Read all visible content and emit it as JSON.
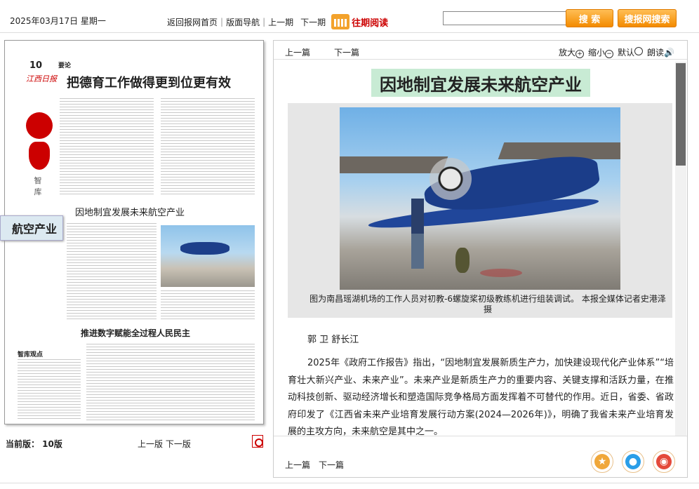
{
  "header": {
    "date": "2025年03月17日 星期一",
    "nav": [
      "返回报网首页",
      "版面导航",
      "上一期",
      "下一期"
    ],
    "past_reading": "往期阅读",
    "search_placeholder": "",
    "search_button": "搜 索",
    "site_search_button": "搜报网搜索"
  },
  "page_preview": {
    "page_number": "10",
    "masthead": "江西日报",
    "column_label": "要论",
    "headline": "把德育工作做得更到位更有效",
    "sidebar_label": "智\n库",
    "sub_article": "因地制宜发展未来航空产业",
    "sub_article2": "推进数字赋能全过程人民民主",
    "column_label2": "智库观点",
    "callout": "航空产业"
  },
  "left_footer": {
    "current_edition": "当前版： 10版",
    "prev_edition": "上一版",
    "next_edition": "下一版"
  },
  "article": {
    "top_prev": "上一篇",
    "top_next": "下一篇",
    "tools": {
      "zoom_in": "放大",
      "zoom_out": "缩小",
      "default": "默认",
      "read": "朗读"
    },
    "title": "因地制宜发展未来航空产业",
    "caption": "图为南昌瑶湖机场的工作人员对初教-6螺旋桨初级教练机进行组装调试。 本报全媒体记者史港泽摄",
    "author": "郭 卫  舒长江",
    "body": "2025年《政府工作报告》指出，“因地制宜发展新质生产力，加快建设现代化产业体系”“培育壮大新兴产业、未来产业”。未来产业是新质生产力的重要内容、关键支撑和活跃力量，在推动科技创新、驱动经济增长和塑造国际竞争格局方面发挥着不可替代的作用。近日，省委、省政府印发了《江西省未来产业培育发展行动方案(2024—2026年)》，明确了我省未来产业培育发展的主攻方向，未来航空是其中之一。",
    "bottom_prev": "上一篇",
    "bottom_next": "下一篇"
  },
  "share_icons": [
    "favorite-icon",
    "qq-icon",
    "weibo-icon"
  ]
}
